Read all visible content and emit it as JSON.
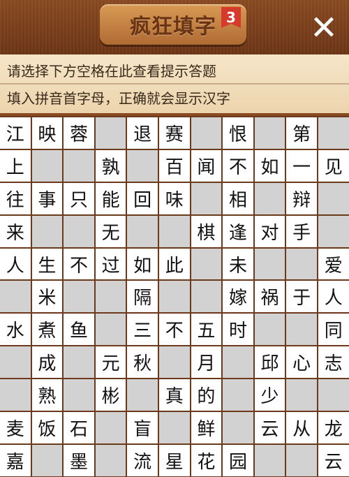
{
  "header": {
    "title": "疯狂填字",
    "level": "3",
    "close_symbol": "✕"
  },
  "hints": {
    "line1": "请选择下方空格在此查看提示答题",
    "line2": "填入拼音首字母，正确就会显示汉字"
  },
  "grid": {
    "rows": [
      [
        "江",
        "映",
        "蓉",
        null,
        "退",
        "赛",
        null,
        "恨",
        null,
        "第",
        null
      ],
      [
        "上",
        null,
        null,
        "孰",
        null,
        "百",
        "闻",
        "不",
        "如",
        "一",
        "见"
      ],
      [
        "往",
        "事",
        "只",
        "能",
        "回",
        "味",
        null,
        "相",
        null,
        "辩",
        null
      ],
      [
        "来",
        null,
        null,
        "无",
        null,
        null,
        "棋",
        "逢",
        "对",
        "手",
        null
      ],
      [
        "人",
        "生",
        "不",
        "过",
        "如",
        "此",
        null,
        "未",
        null,
        null,
        "爱"
      ],
      [
        null,
        "米",
        null,
        null,
        "隔",
        null,
        null,
        "嫁",
        "祸",
        "于",
        "人"
      ],
      [
        "水",
        "煮",
        "鱼",
        null,
        "三",
        "不",
        "五",
        "时",
        null,
        null,
        "同"
      ],
      [
        null,
        "成",
        null,
        "元",
        "秋",
        null,
        "月",
        null,
        "邱",
        "心",
        "志"
      ],
      [
        null,
        "熟",
        null,
        "彬",
        null,
        "真",
        "的",
        null,
        "少",
        null,
        null
      ],
      [
        "麦",
        "饭",
        "石",
        null,
        "盲",
        null,
        "鲜",
        null,
        "云",
        "从",
        "龙"
      ],
      [
        "嘉",
        null,
        "墨",
        null,
        "流",
        "星",
        "花",
        "园",
        null,
        null,
        "云"
      ]
    ]
  }
}
